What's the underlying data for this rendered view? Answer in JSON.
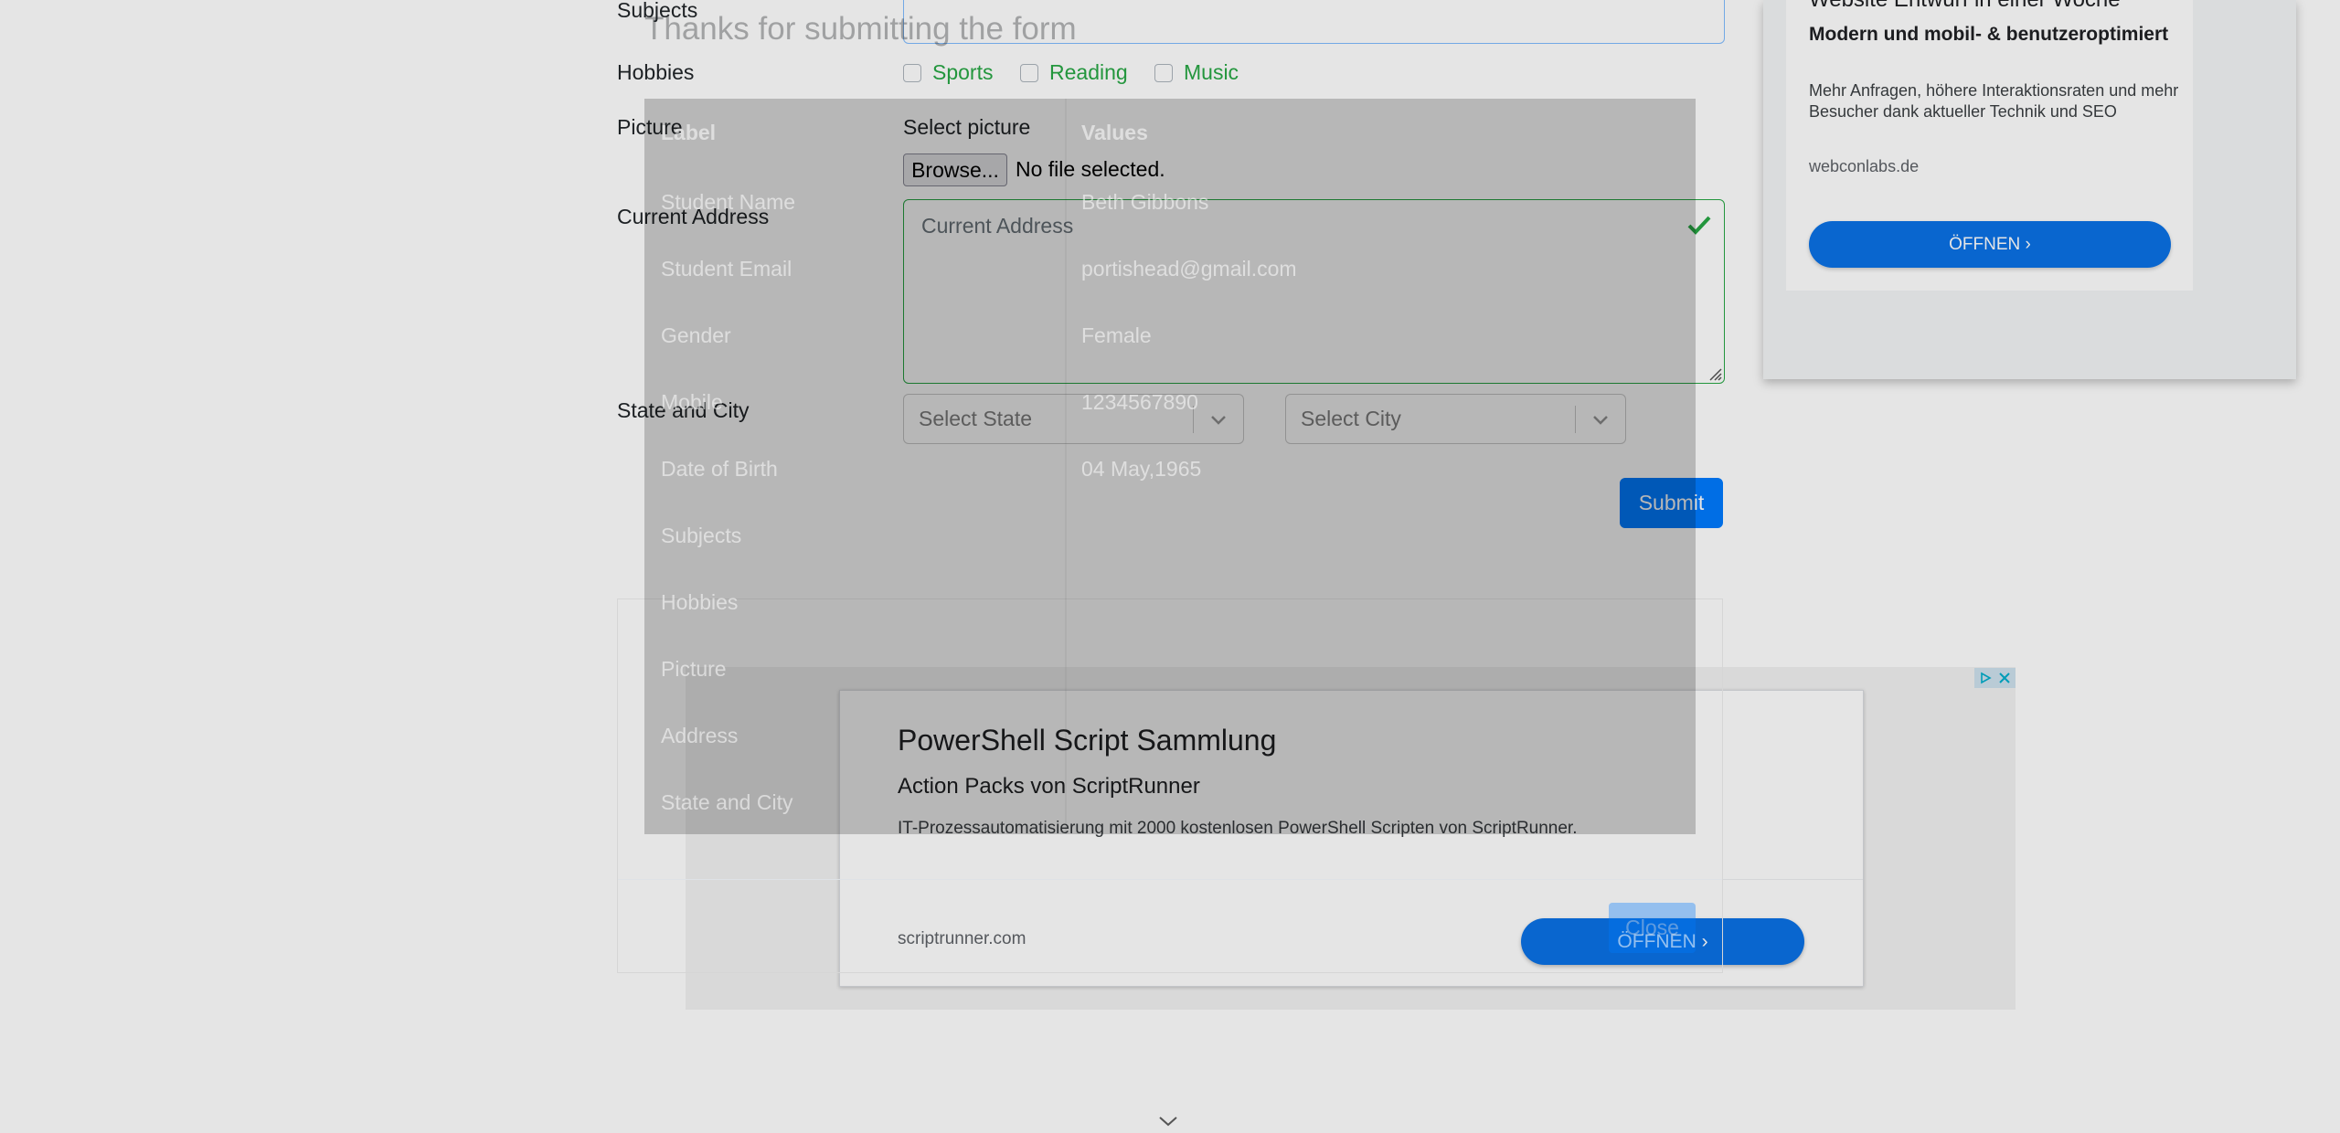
{
  "form": {
    "subjects_label": "Subjects",
    "hobbies_label": "Hobbies",
    "hobbies": [
      "Sports",
      "Reading",
      "Music"
    ],
    "picture_label": "Picture",
    "select_picture_label": "Select picture",
    "browse_label": "Browse...",
    "file_status": "No file selected.",
    "address_label": "Current Address",
    "address_placeholder": "Current Address",
    "state_city_label": "State and City",
    "state_placeholder": "Select State",
    "city_placeholder": "Select City",
    "submit_label": "Submit"
  },
  "modal": {
    "title": "Thanks for submitting the form",
    "table_headers": [
      "Label",
      "Values"
    ],
    "rows": [
      {
        "label": "Student Name",
        "value": "Beth Gibbons"
      },
      {
        "label": "Student Email",
        "value": "portishead@gmail.com"
      },
      {
        "label": "Gender",
        "value": "Female"
      },
      {
        "label": "Mobile",
        "value": "1234567890"
      },
      {
        "label": "Date of Birth",
        "value": "04 May,1965"
      },
      {
        "label": "Subjects",
        "value": ""
      },
      {
        "label": "Hobbies",
        "value": ""
      },
      {
        "label": "Picture",
        "value": ""
      },
      {
        "label": "Address",
        "value": ""
      },
      {
        "label": "State and City",
        "value": ""
      }
    ],
    "close_label": "Close"
  },
  "ad_right": {
    "headline": "Website Entwurf in einer Woche",
    "subheadline": "Modern und mobil- & benutzeroptimiert",
    "body": "Mehr Anfragen, höhere Interaktionsraten und mehr Besucher dank aktueller Technik und SEO",
    "domain": "webconlabs.de",
    "button_label": "ÖFFNEN"
  },
  "ad_bottom": {
    "title": "PowerShell Script Sammlung",
    "subtitle": "Action Packs von ScriptRunner",
    "body": "IT-Prozessautomatisierung mit 2000 kostenlosen PowerShell Scripten von ScriptRunner.",
    "domain": "scriptrunner.com",
    "button_label": "ÖFFNEN"
  },
  "colors": {
    "accent": "#007bff",
    "hobby_text": "#28a745",
    "ad_button": "#0b72e7"
  }
}
